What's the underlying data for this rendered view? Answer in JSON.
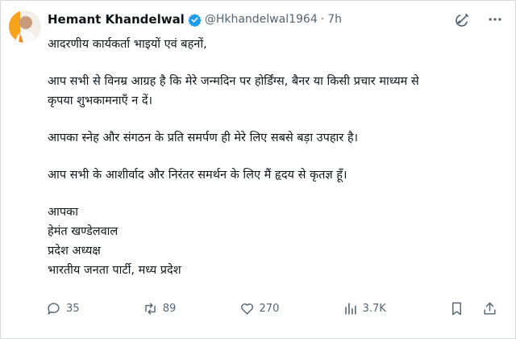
{
  "author": {
    "name": "Hemant Khandelwal",
    "handle": "@Hkhandelwal1964",
    "separator": "·",
    "time": "7h"
  },
  "post": {
    "lines": [
      "आदरणीय कार्यकर्ता भाइयों एवं बहनों,",
      "आप सभी से विनम्र आग्रह है कि मेरे जन्मदिन पर होर्डिंग्स, बैनर या किसी प्रचार माध्यम से",
      "कृपया शुभकामनाएँ न दें।",
      "आपका स्नेह और संगठन के प्रति समर्पण ही मेरे लिए सबसे बड़ा उपहार है।",
      "आप सभी के आशीर्वाद और निरंतर समर्थन के लिए मैं हृदय से कृतज्ञ हूँ।",
      "आपका",
      "हेमंत खण्डेलवाल",
      "प्रदेश अध्यक्ष",
      "भारतीय जनता पार्टी, मध्य प्रदेश"
    ]
  },
  "metrics": {
    "replies": "35",
    "reposts": "89",
    "likes": "270",
    "views": "3.7K"
  },
  "icons": {
    "top": [
      "grok-icon",
      "more-icon"
    ],
    "actions": [
      "reply-icon",
      "repost-icon",
      "like-icon",
      "views-icon",
      "bookmark-icon",
      "share-icon"
    ]
  },
  "colors": {
    "verified": "#1d9bf0",
    "muted": "#536471",
    "text": "#0f1419"
  }
}
